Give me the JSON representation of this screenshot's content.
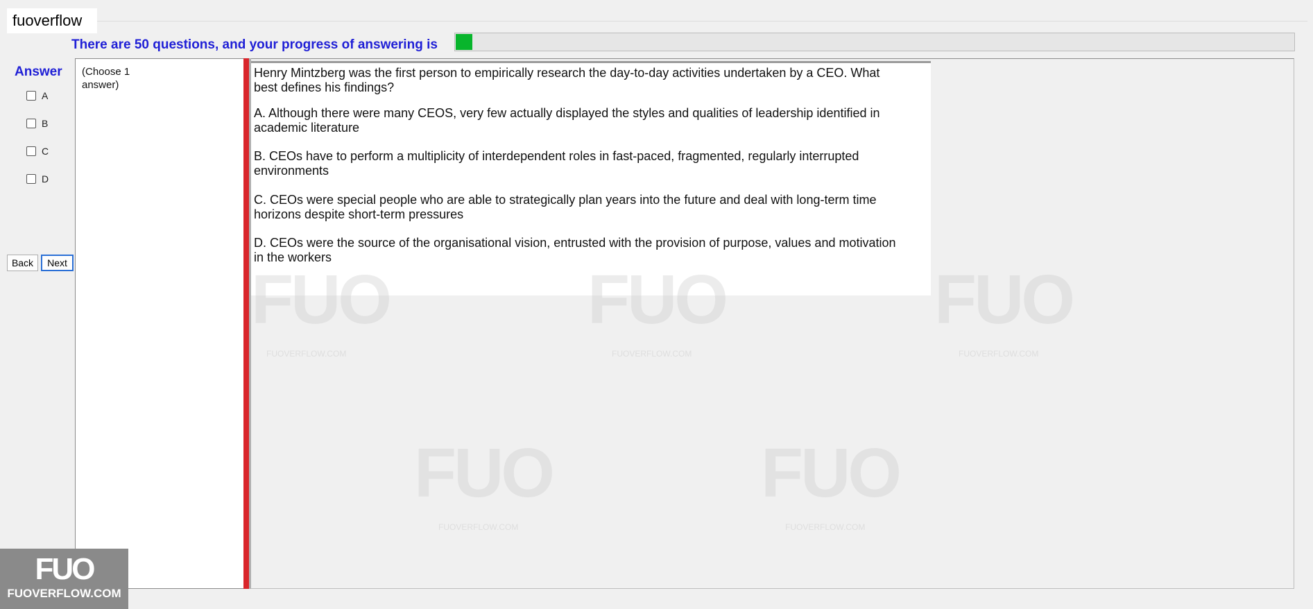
{
  "window": {
    "title": "fuoverflow"
  },
  "progress": {
    "label": "There are 50 questions, and your progress of answering is",
    "fraction": 0.02,
    "color": "#08b52c"
  },
  "answer_panel": {
    "heading": "Answer",
    "options": [
      "A",
      "B",
      "C",
      "D"
    ]
  },
  "nav": {
    "back_label": "Back",
    "next_label": "Next"
  },
  "hint": "(Choose 1 answer)",
  "question": {
    "text": "Henry Mintzberg was the first person to empirically research the day-to-day activities undertaken by a CEO. What best defines his findings?",
    "answers": [
      "A.  Although there were many CEOS, very few actually displayed the styles and qualities of leadership identified in academic literature",
      "B.  CEOs have to perform a multiplicity of interdependent roles in fast-paced, fragmented, regularly interrupted environments",
      "C.  CEOs were special people who are able to strategically plan years into the future and deal with long-term time horizons despite short-term pressures",
      "D.  CEOs were the source of the organisational vision, entrusted with the provision of purpose, values and motivation in the workers"
    ]
  },
  "watermark": {
    "logo_text": "FUO",
    "site_text": "FUOVERFLOW.COM"
  },
  "accent_colors": {
    "heading_blue": "#1f1fd6",
    "divider_red": "#d9262b"
  }
}
